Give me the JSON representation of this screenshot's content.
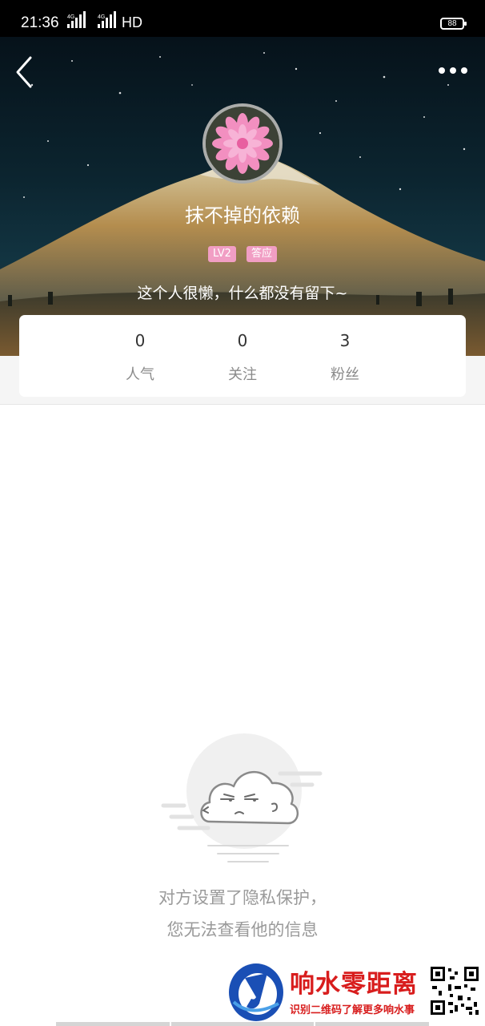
{
  "status_bar": {
    "time": "21:36",
    "signal1_label": "4G",
    "signal2_label": "4G",
    "hd_label": "HD",
    "battery": "88"
  },
  "profile": {
    "username": "抹不掉的依赖",
    "badges": [
      "LV2",
      "答应"
    ],
    "bio": "这个人很懒，什么都没有留下~",
    "badge_color": "#f19ec4"
  },
  "stats": [
    {
      "value": "0",
      "label": "人气"
    },
    {
      "value": "0",
      "label": "关注"
    },
    {
      "value": "3",
      "label": "粉丝"
    }
  ],
  "empty_state": {
    "line1": "对方设置了隐私保护，",
    "line2": "您无法查看他的信息",
    "icon": "cloud-face-icon"
  },
  "watermark": {
    "title": "响水零距离",
    "subtitle": "识别二维码了解更多响水事",
    "color": "#d81d1d"
  },
  "icons": {
    "back": "chevron-left-icon",
    "more": "more-dots-icon"
  }
}
